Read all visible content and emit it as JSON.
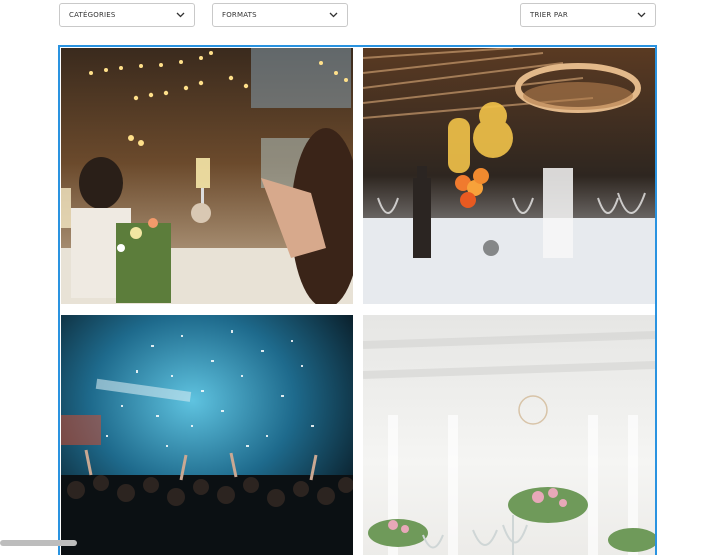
{
  "filters": {
    "categories_label": "CATÉGORIES",
    "formats_label": "FORMATS",
    "sort_label": "TRIER PAR"
  },
  "gallery": {
    "accent_border": "#2a93e0",
    "tiles": [
      {
        "subject": "wedding-toast-photo"
      },
      {
        "subject": "birthday-dinner-photo"
      },
      {
        "subject": "concert-confetti-photo"
      },
      {
        "subject": "white-tent-table-photo"
      }
    ]
  }
}
